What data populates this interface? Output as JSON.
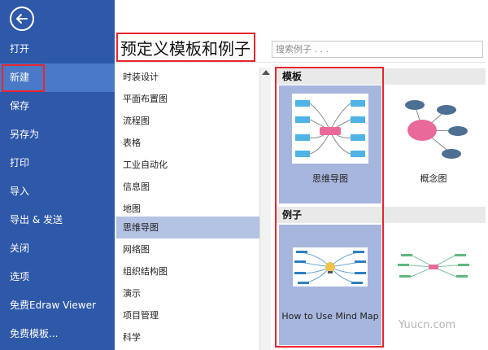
{
  "nav": {
    "items": [
      "打开",
      "新建",
      "保存",
      "另存为",
      "打印",
      "导入",
      "导出 & 发送",
      "关闭",
      "选项",
      "免费Edraw Viewer",
      "免费模板..."
    ],
    "active_index": 1
  },
  "header": {
    "title": "预定义模板和例子",
    "search_placeholder": "搜索例子 . . ."
  },
  "categories": {
    "items": [
      "时装设计",
      "平面布置图",
      "流程图",
      "表格",
      "工业自动化",
      "信息图",
      "地图",
      "思维导图",
      "网络图",
      "组织结构图",
      "演示",
      "项目管理",
      "科学"
    ],
    "selected_index": 7
  },
  "templates": {
    "section_label": "模板",
    "items": [
      {
        "label": "思维导图",
        "icon": "mind-map-thumbnail"
      },
      {
        "label": "概念图",
        "icon": "concept-map-thumbnail"
      }
    ]
  },
  "examples": {
    "section_label": "例子",
    "items": [
      {
        "label": "How to Use Mind Map",
        "icon": "mind-map-example-thumbnail"
      },
      {
        "label": "",
        "icon": "mind-map-example-2-thumbnail"
      }
    ]
  },
  "watermark": "Yuucn.com",
  "colors": {
    "nav_bg": "#2e58a8",
    "highlight_red": "#e8262b",
    "selected_bg": "#a7b6dd",
    "node_blue": "#4fb3e5",
    "node_pink": "#e96a9a",
    "concept_dark": "#4d6f93"
  }
}
